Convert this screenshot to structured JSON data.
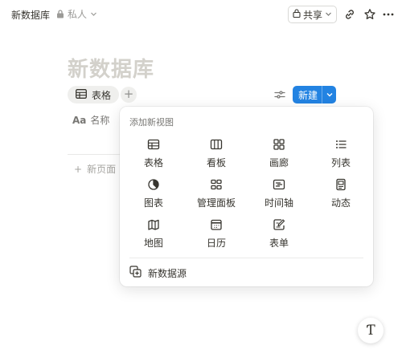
{
  "topbar": {
    "title": "新数据库",
    "privacy_label": "私人",
    "share_label": "共享"
  },
  "page": {
    "title": "新数据库",
    "view_tab_label": "表格",
    "add_view_symbol": "+",
    "new_button_label": "新建",
    "column_name_label": "名称",
    "column_type_glyph": "Aa",
    "new_page_label": "新页面",
    "new_page_symbol": "+"
  },
  "menu": {
    "heading": "添加新视图",
    "items": [
      {
        "label": "表格",
        "icon": "table-icon"
      },
      {
        "label": "看板",
        "icon": "board-icon"
      },
      {
        "label": "画廊",
        "icon": "gallery-icon"
      },
      {
        "label": "列表",
        "icon": "list-icon"
      },
      {
        "label": "图表",
        "icon": "chart-icon"
      },
      {
        "label": "管理面板",
        "icon": "dashboard-icon"
      },
      {
        "label": "时间轴",
        "icon": "timeline-icon"
      },
      {
        "label": "动态",
        "icon": "feed-icon"
      },
      {
        "label": "地图",
        "icon": "map-icon"
      },
      {
        "label": "日历",
        "icon": "calendar-icon"
      },
      {
        "label": "表单",
        "icon": "form-icon"
      }
    ],
    "footer_label": "新数据源"
  },
  "help": {
    "glyph": "Ƭ"
  },
  "colors": {
    "accent": "#2383e2",
    "title_placeholder": "#d3d1cb",
    "text": "#37352f",
    "muted": "#787774"
  }
}
